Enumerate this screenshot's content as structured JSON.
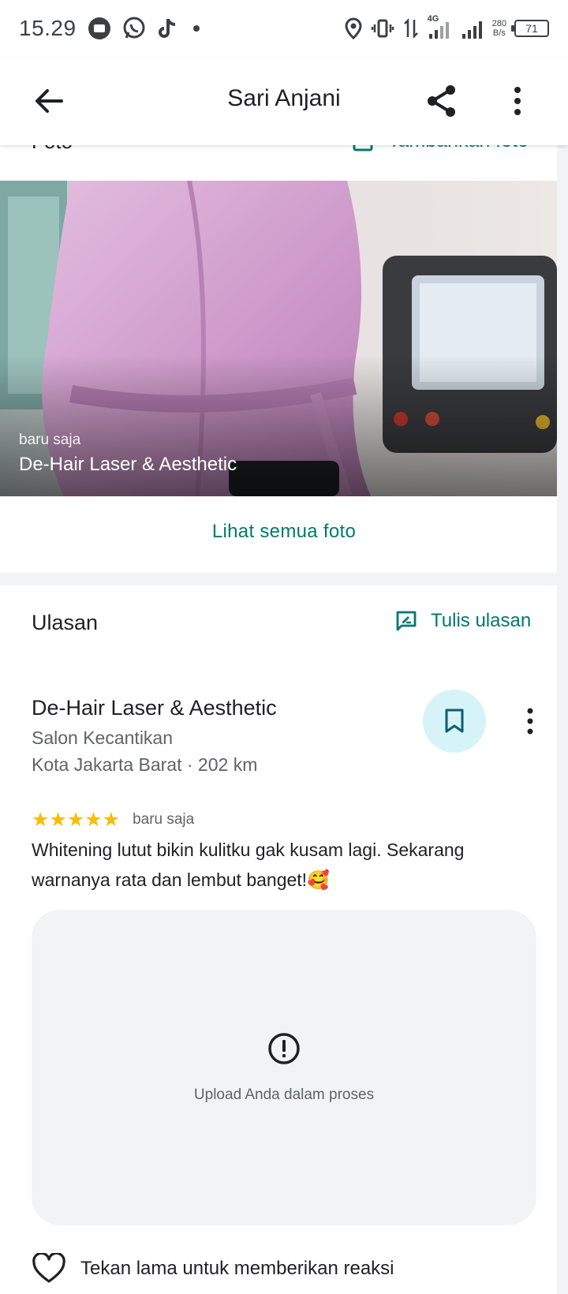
{
  "status_bar": {
    "time": "15.29",
    "network_type": "4G",
    "net_speed_value": "280",
    "net_speed_unit": "B/s",
    "battery": "71"
  },
  "app_bar": {
    "title": "Sari Anjani"
  },
  "photos_section": {
    "title": "Foto",
    "add_photo_label": "Tambahkan foto",
    "photo_time": "baru saja",
    "photo_place": "De-Hair Laser & Aesthetic",
    "see_all_label": "Lihat semua foto"
  },
  "reviews_section": {
    "title": "Ulasan",
    "write_review_label": "Tulis ulasan",
    "review": {
      "place_name": "De-Hair Laser & Aesthetic",
      "category": "Salon Kecantikan",
      "location": "Kota Jakarta Barat · 202 km",
      "stars": "★★★★★",
      "rating": 5,
      "time": "baru saja",
      "text": "Whitening lutut bikin kulitku gak kusam lagi. Sekarang warnanya rata dan lembut banget!🥰",
      "upload_status": "Upload Anda dalam proses",
      "reaction_hint": "Tekan lama untuk memberikan reaksi"
    }
  },
  "colors": {
    "accent": "#00796b",
    "star": "#fbbc04",
    "save_bg": "#d6f3f8",
    "card_bg": "#f1f3f4"
  }
}
